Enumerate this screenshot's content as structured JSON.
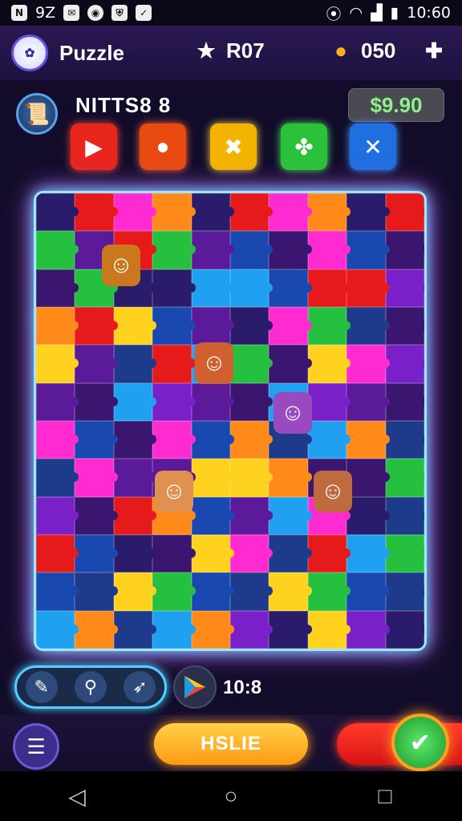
{
  "status_bar": {
    "left_icons": [
      "N",
      "Ø",
      "✓"
    ],
    "signal": "9Z",
    "time": "10:60"
  },
  "header": {
    "title": "Puzzle",
    "stat_1": "R07",
    "stat_2": "050"
  },
  "level": {
    "name": "NITTS8 8",
    "money": "$9.90"
  },
  "tools": [
    {
      "icon": "video-icon",
      "color": "#e8261e"
    },
    {
      "icon": "apple-icon",
      "color": "#e84a12"
    },
    {
      "icon": "hammer-icon",
      "color": "#f2b400"
    },
    {
      "icon": "puzzle-icon",
      "color": "#2bc23a"
    },
    {
      "icon": "cross-tools-icon",
      "color": "#1f6fe0"
    }
  ],
  "bottom": {
    "timer": "10:8"
  },
  "footer": {
    "main_button": "HSLIE"
  },
  "colors": {
    "accent": "#4fd0ff",
    "money_text": "#8ef08a",
    "board_glow": "#c25cff"
  }
}
